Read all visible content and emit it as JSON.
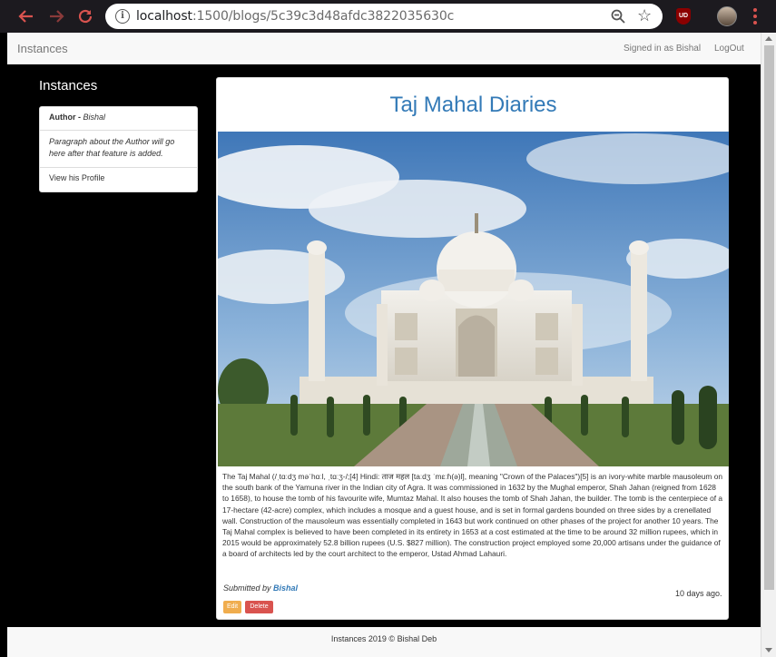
{
  "browser": {
    "url_host": "localhost",
    "url_rest": ":1500/blogs/5c39c3d48afdc3822035630c",
    "extension_badge": "UD",
    "icons": [
      "back-arrow-icon",
      "forward-arrow-icon",
      "reload-icon",
      "info-icon",
      "zoom-icon",
      "star-icon",
      "extension-icon",
      "profile-avatar",
      "menu-icon"
    ]
  },
  "navbar": {
    "brand": "Instances",
    "signed_in": "Signed in as Bishal",
    "logout": "LogOut"
  },
  "sidebar": {
    "title": "Instances",
    "author_label": "Author - ",
    "author_name": "Bishal",
    "paragraph": "Paragraph about the Author will go here after that feature is added.",
    "profile_link": "View his Profile"
  },
  "post": {
    "title": "Taj Mahal Diaries",
    "body": "The Taj Mahal (/ˌtɑːdʒ məˈhɑːl, ˌtɑːʒ-/;[4] Hindi: ताज महल [taːdʒ ˈmɛːɦ(ə)l], meaning \"Crown of the Palaces\")[5] is an ivory-white marble mausoleum on the south bank of the Yamuna river in the Indian city of Agra. It was commissioned in 1632 by the Mughal emperor, Shah Jahan (reigned from 1628 to 1658), to house the tomb of his favourite wife, Mumtaz Mahal. It also houses the tomb of Shah Jahan, the builder. The tomb is the centerpiece of a 17-hectare (42-acre) complex, which includes a mosque and a guest house, and is set in formal gardens bounded on three sides by a crenellated wall. Construction of the mausoleum was essentially completed in 1643 but work continued on other phases of the project for another 10 years. The Taj Mahal complex is believed to have been completed in its entirety in 1653 at a cost estimated at the time to be around 32 million rupees, which in 2015 would be approximately 52.8 billion rupees (U.S. $827 million). The construction project employed some 20,000 artisans under the guidance of a board of architects led by the court architect to the emperor, Ustad Ahmad Lahauri.",
    "submitted_label": "Submitted by ",
    "submitted_by": "Bishal",
    "time_ago": "10 days ago.",
    "edit_label": "Edit",
    "delete_label": "Delete"
  },
  "footer": {
    "text": "Instances 2019 © Bishal Deb"
  },
  "colors": {
    "link": "#337ab7",
    "edit": "#f0ad4e",
    "delete": "#d9534f",
    "page_bg": "#000000"
  }
}
